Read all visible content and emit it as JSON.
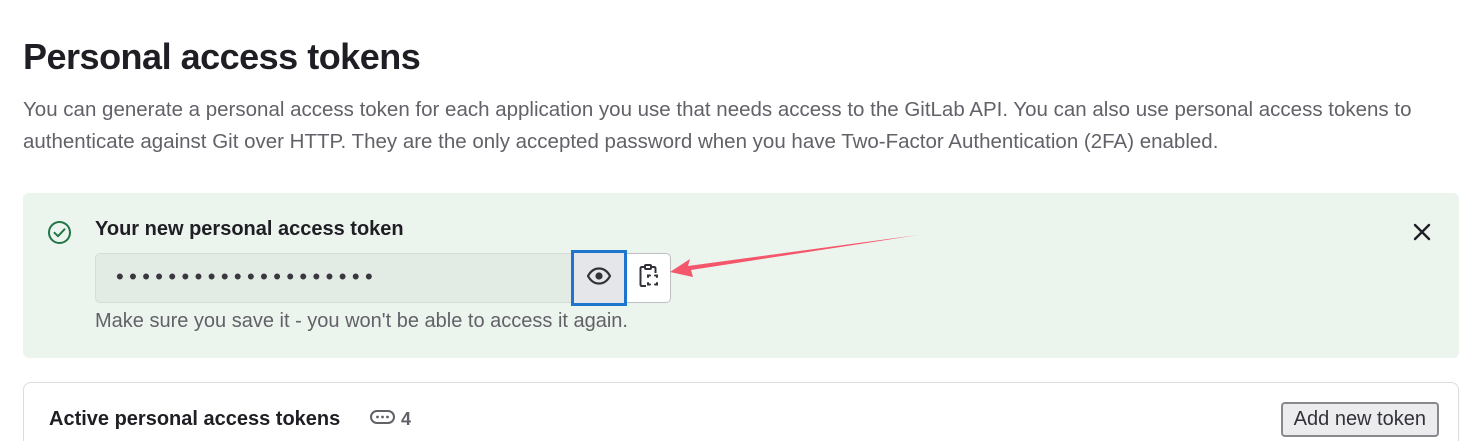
{
  "header": {
    "title": "Personal access tokens",
    "description": "You can generate a personal access token for each application you use that needs access to the GitLab API. You can also use personal access tokens to authenticate against Git over HTTP. They are the only accepted password when you have Two-Factor Authentication (2FA) enabled."
  },
  "alert": {
    "icon": "check-circle-icon",
    "title": "Your new personal access token",
    "token_masked": "••••••••••••••••••••",
    "reveal_icon": "eye-icon",
    "copy_icon": "clipboard-icon",
    "close_icon": "close-icon",
    "hint": "Make sure you save it - you won't be able to access it again."
  },
  "tokens_card": {
    "title": "Active personal access tokens",
    "count_icon": "token-icon",
    "count": "4",
    "add_button_label": "Add new token"
  },
  "colors": {
    "alert_bg": "#ecf4ee",
    "success": "#217645",
    "focus_border": "#1f75cb",
    "annotation_arrow": "#f4566b"
  }
}
